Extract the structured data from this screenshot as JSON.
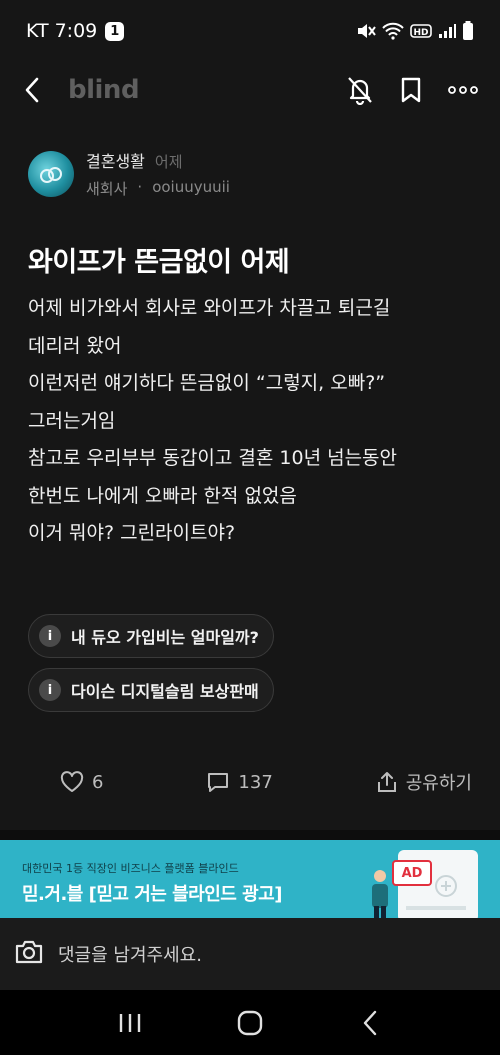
{
  "status_bar": {
    "carrier": "KT",
    "time": "7:09",
    "notification_count": "1",
    "icons": [
      "mute-icon",
      "wifi-icon",
      "hd-volte-icon",
      "signal-icon",
      "battery-icon"
    ]
  },
  "topbar": {
    "brand": "blind",
    "icons": [
      "back-icon",
      "notification-off-icon",
      "bookmark-icon",
      "more-icon"
    ]
  },
  "author": {
    "channel": "결혼생활",
    "time": "어제",
    "company": "새회사",
    "separator": "·",
    "nickname": "ooiuuyuuii"
  },
  "post": {
    "title": "와이프가 뜬금없이 어제",
    "body_lines": [
      "어제 비가와서 회사로 와이프가 차끌고 퇴근길",
      "데리러 왔어",
      "이런저런 얘기하다 뜬금없이 “그렇지, 오빠?”",
      "그러는거임",
      "참고로 우리부부 동갑이고 결혼 10년 넘는동안",
      "한번도 나에게 오빠라 한적 없었음",
      "이거 뭐야? 그린라이트야?"
    ]
  },
  "topics": [
    {
      "icon_text": "i",
      "label": "내 듀오 가입비는 얼마일까?"
    },
    {
      "icon_text": "i",
      "label": "다이슨 디지털슬림 보상판매"
    }
  ],
  "reactions": {
    "likes": "6",
    "comments": "137",
    "share_label": "공유하기"
  },
  "ad": {
    "subtitle": "대한민국 1등 직장인 비즈니스 플랫폼 블라인드",
    "headline": "믿.거.블 [믿고 거는 블라인드 광고]",
    "badge": "AD",
    "color": "#2fb3c7"
  },
  "comment_input": {
    "placeholder": "댓글을 남겨주세요."
  },
  "navbar": {
    "icons": [
      "recent-apps-icon",
      "home-icon",
      "back-nav-icon"
    ]
  }
}
